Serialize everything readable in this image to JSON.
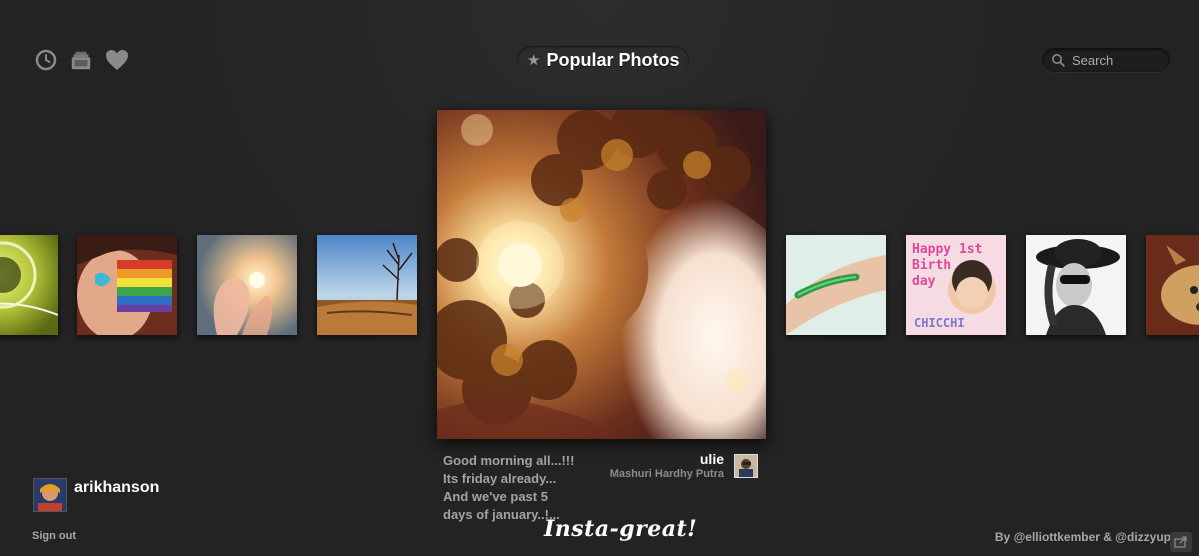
{
  "header": {
    "title": "Popular Photos",
    "star_glyph": "★",
    "nav_icons": [
      "clock-icon",
      "photos-icon",
      "heart-icon"
    ],
    "search_placeholder": "Search"
  },
  "featured": {
    "caption": "Good morning all...!!!\nIts friday already...\nAnd we've past 5\ndays of january..!...",
    "username": "ulie",
    "full_name": "Mashuri Hardhy Putra"
  },
  "thumbnails": [
    {
      "name": "thumb-green-abstract"
    },
    {
      "name": "thumb-rainbow-face"
    },
    {
      "name": "thumb-sun-hand"
    },
    {
      "name": "thumb-tree-landscape"
    },
    {
      "name": "thumb-arm-tattoo"
    },
    {
      "name": "thumb-birthday-baby"
    },
    {
      "name": "thumb-bw-portrait"
    },
    {
      "name": "thumb-dog"
    }
  ],
  "user": {
    "username": "arikhanson",
    "sign_out_label": "Sign out"
  },
  "logo_text": "Insta-great!",
  "credits": {
    "prefix": "By ",
    "author1": "@elliottkember",
    "separator": " & ",
    "author2": "@dizzyup"
  },
  "colors": {
    "background": "#232323",
    "accent_text": "#ffffff",
    "muted_text": "#a3a3a3"
  }
}
